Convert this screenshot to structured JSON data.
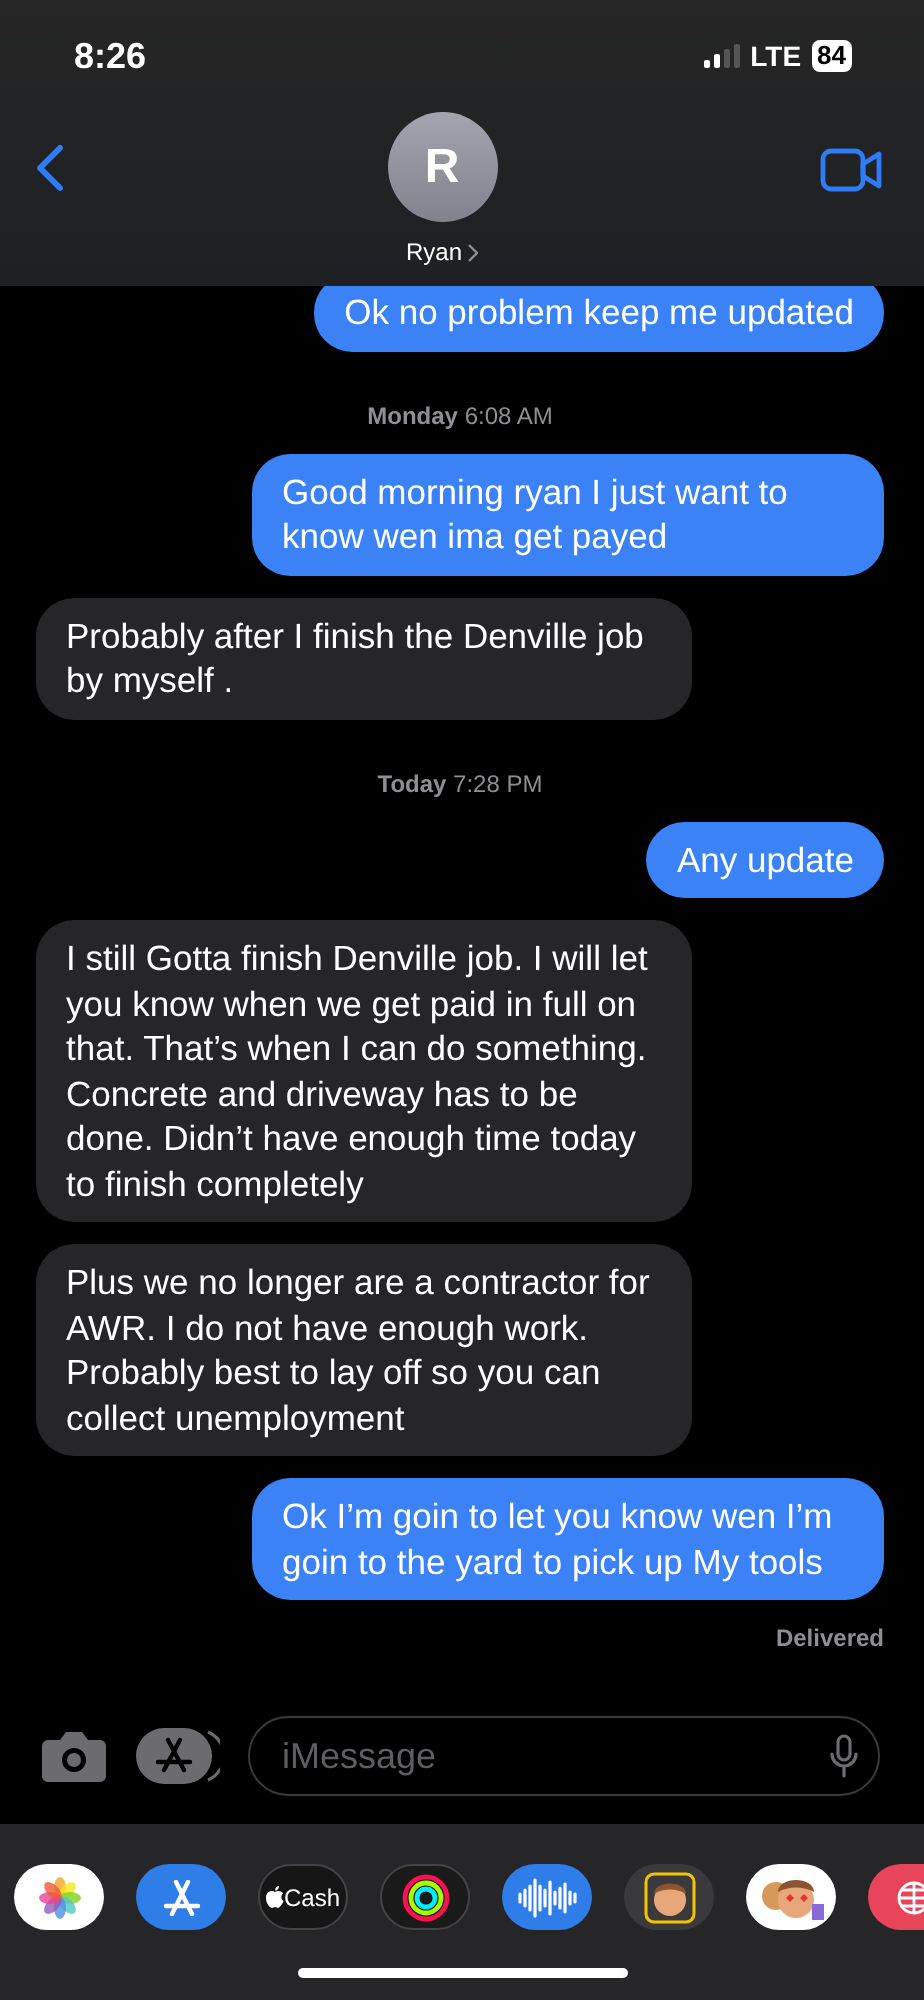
{
  "status_bar": {
    "time": "8:26",
    "network": "LTE",
    "battery": "84"
  },
  "header": {
    "avatar_initial": "R",
    "contact_name": "Ryan"
  },
  "messages": [
    {
      "kind": "sent",
      "text": "Ok no problem keep me updated"
    },
    {
      "kind": "timestamp",
      "text": "**Monday** 6:08 AM"
    },
    {
      "kind": "sent",
      "text": "Good morning ryan I just want to know wen ima get payed"
    },
    {
      "kind": "received",
      "text": "Probably after I finish the Denville job by myself ."
    },
    {
      "kind": "timestamp",
      "text": "**Today** 7:28 PM"
    },
    {
      "kind": "sent",
      "text": "Any update"
    },
    {
      "kind": "received",
      "text": "I still Gotta finish Denville job. I will let you know when we get paid in full on that. That’s when I can do something. Concrete and driveway has to be done. Didn’t have enough time today to finish completely"
    },
    {
      "kind": "received",
      "text": "Plus we no longer are a contractor for AWR. I do not have enough work. Probably best to lay off so you can collect unemployment"
    },
    {
      "kind": "sent",
      "text": "Ok I’m goin to let you know wen I’m goin to the yard to pick up My tools"
    }
  ],
  "delivery_status": "Delivered",
  "composer": {
    "placeholder": "iMessage"
  },
  "app_drawer": [
    {
      "kind": "photos"
    },
    {
      "kind": "appstore"
    },
    {
      "kind": "cash",
      "label": "Cash"
    },
    {
      "kind": "activity"
    },
    {
      "kind": "audio"
    },
    {
      "kind": "memoji"
    },
    {
      "kind": "stickers"
    },
    {
      "kind": "globe"
    }
  ]
}
